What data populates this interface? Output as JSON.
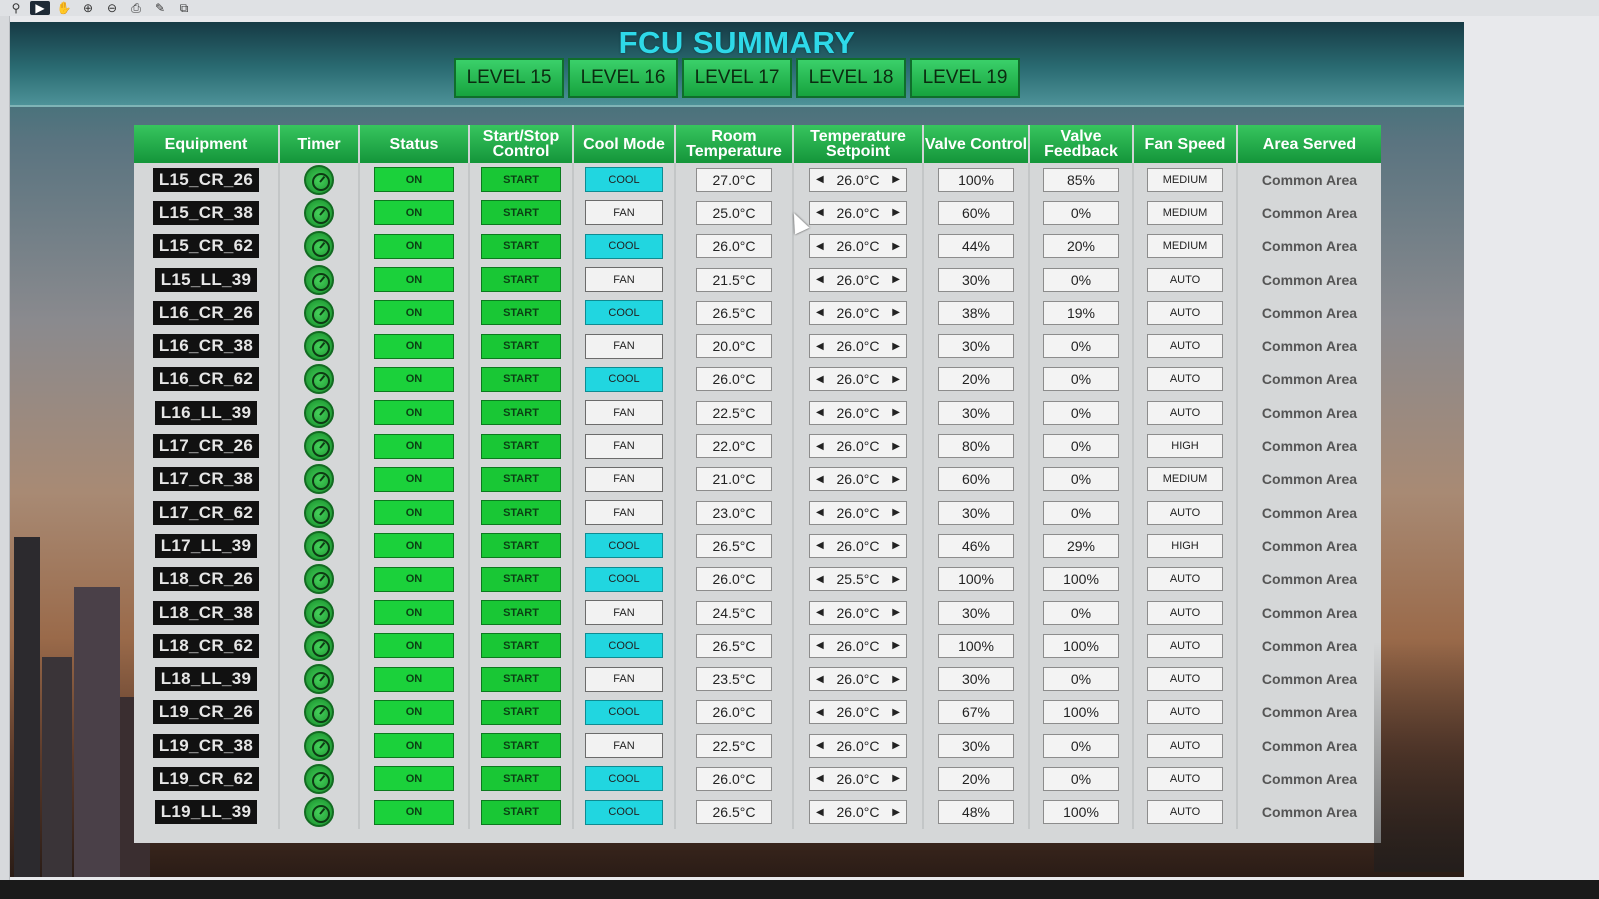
{
  "toolbar": {
    "tools": [
      "cursor-tool-icon",
      "select-icon",
      "hand-icon",
      "zoom-in-icon",
      "zoom-out-icon",
      "print-icon",
      "wrench-icon",
      "fit-page-icon"
    ]
  },
  "title": "FCU SUMMARY",
  "level_tabs": [
    "LEVEL 15",
    "LEVEL 16",
    "LEVEL 17",
    "LEVEL 18",
    "LEVEL 19"
  ],
  "colors": {
    "title": "#2ed9e8",
    "header_green": "#14953a",
    "on_green": "#1bd13b",
    "cool_cyan": "#21d6e0"
  },
  "columns": {
    "equipment": "Equipment",
    "timer": "Timer",
    "status": "Status",
    "start_stop": "Start/Stop Control",
    "cool_mode": "Cool Mode",
    "room_temp": "Room Temperature",
    "setpoint": "Temperature Setpoint",
    "valve_control": "Valve Control",
    "valve_feedback": "Valve Feedback",
    "fan_speed": "Fan Speed",
    "area_served": "Area Served"
  },
  "rows": [
    {
      "equipment": "L15_CR_26",
      "status": "ON",
      "control": "START",
      "mode": "COOL",
      "room_temp": "27.0°C",
      "setpoint": "26.0°C",
      "valve_control": "100%",
      "valve_feedback": "85%",
      "fan_speed": "MEDIUM",
      "area": "Common Area"
    },
    {
      "equipment": "L15_CR_38",
      "status": "ON",
      "control": "START",
      "mode": "FAN",
      "room_temp": "25.0°C",
      "setpoint": "26.0°C",
      "valve_control": "60%",
      "valve_feedback": "0%",
      "fan_speed": "MEDIUM",
      "area": "Common Area"
    },
    {
      "equipment": "L15_CR_62",
      "status": "ON",
      "control": "START",
      "mode": "COOL",
      "room_temp": "26.0°C",
      "setpoint": "26.0°C",
      "valve_control": "44%",
      "valve_feedback": "20%",
      "fan_speed": "MEDIUM",
      "area": "Common Area"
    },
    {
      "equipment": "L15_LL_39",
      "status": "ON",
      "control": "START",
      "mode": "FAN",
      "room_temp": "21.5°C",
      "setpoint": "26.0°C",
      "valve_control": "30%",
      "valve_feedback": "0%",
      "fan_speed": "AUTO",
      "area": "Common Area"
    },
    {
      "equipment": "L16_CR_26",
      "status": "ON",
      "control": "START",
      "mode": "COOL",
      "room_temp": "26.5°C",
      "setpoint": "26.0°C",
      "valve_control": "38%",
      "valve_feedback": "19%",
      "fan_speed": "AUTO",
      "area": "Common Area"
    },
    {
      "equipment": "L16_CR_38",
      "status": "ON",
      "control": "START",
      "mode": "FAN",
      "room_temp": "20.0°C",
      "setpoint": "26.0°C",
      "valve_control": "30%",
      "valve_feedback": "0%",
      "fan_speed": "AUTO",
      "area": "Common Area"
    },
    {
      "equipment": "L16_CR_62",
      "status": "ON",
      "control": "START",
      "mode": "COOL",
      "room_temp": "26.0°C",
      "setpoint": "26.0°C",
      "valve_control": "20%",
      "valve_feedback": "0%",
      "fan_speed": "AUTO",
      "area": "Common Area"
    },
    {
      "equipment": "L16_LL_39",
      "status": "ON",
      "control": "START",
      "mode": "FAN",
      "room_temp": "22.5°C",
      "setpoint": "26.0°C",
      "valve_control": "30%",
      "valve_feedback": "0%",
      "fan_speed": "AUTO",
      "area": "Common Area"
    },
    {
      "equipment": "L17_CR_26",
      "status": "ON",
      "control": "START",
      "mode": "FAN",
      "room_temp": "22.0°C",
      "setpoint": "26.0°C",
      "valve_control": "80%",
      "valve_feedback": "0%",
      "fan_speed": "HIGH",
      "area": "Common Area"
    },
    {
      "equipment": "L17_CR_38",
      "status": "ON",
      "control": "START",
      "mode": "FAN",
      "room_temp": "21.0°C",
      "setpoint": "26.0°C",
      "valve_control": "60%",
      "valve_feedback": "0%",
      "fan_speed": "MEDIUM",
      "area": "Common Area"
    },
    {
      "equipment": "L17_CR_62",
      "status": "ON",
      "control": "START",
      "mode": "FAN",
      "room_temp": "23.0°C",
      "setpoint": "26.0°C",
      "valve_control": "30%",
      "valve_feedback": "0%",
      "fan_speed": "AUTO",
      "area": "Common Area"
    },
    {
      "equipment": "L17_LL_39",
      "status": "ON",
      "control": "START",
      "mode": "COOL",
      "room_temp": "26.5°C",
      "setpoint": "26.0°C",
      "valve_control": "46%",
      "valve_feedback": "29%",
      "fan_speed": "HIGH",
      "area": "Common Area"
    },
    {
      "equipment": "L18_CR_26",
      "status": "ON",
      "control": "START",
      "mode": "COOL",
      "room_temp": "26.0°C",
      "setpoint": "25.5°C",
      "valve_control": "100%",
      "valve_feedback": "100%",
      "fan_speed": "AUTO",
      "area": "Common Area"
    },
    {
      "equipment": "L18_CR_38",
      "status": "ON",
      "control": "START",
      "mode": "FAN",
      "room_temp": "24.5°C",
      "setpoint": "26.0°C",
      "valve_control": "30%",
      "valve_feedback": "0%",
      "fan_speed": "AUTO",
      "area": "Common Area"
    },
    {
      "equipment": "L18_CR_62",
      "status": "ON",
      "control": "START",
      "mode": "COOL",
      "room_temp": "26.5°C",
      "setpoint": "26.0°C",
      "valve_control": "100%",
      "valve_feedback": "100%",
      "fan_speed": "AUTO",
      "area": "Common Area"
    },
    {
      "equipment": "L18_LL_39",
      "status": "ON",
      "control": "START",
      "mode": "FAN",
      "room_temp": "23.5°C",
      "setpoint": "26.0°C",
      "valve_control": "30%",
      "valve_feedback": "0%",
      "fan_speed": "AUTO",
      "area": "Common Area"
    },
    {
      "equipment": "L19_CR_26",
      "status": "ON",
      "control": "START",
      "mode": "COOL",
      "room_temp": "26.0°C",
      "setpoint": "26.0°C",
      "valve_control": "67%",
      "valve_feedback": "100%",
      "fan_speed": "AUTO",
      "area": "Common Area"
    },
    {
      "equipment": "L19_CR_38",
      "status": "ON",
      "control": "START",
      "mode": "FAN",
      "room_temp": "22.5°C",
      "setpoint": "26.0°C",
      "valve_control": "30%",
      "valve_feedback": "0%",
      "fan_speed": "AUTO",
      "area": "Common Area"
    },
    {
      "equipment": "L19_CR_62",
      "status": "ON",
      "control": "START",
      "mode": "COOL",
      "room_temp": "26.0°C",
      "setpoint": "26.0°C",
      "valve_control": "20%",
      "valve_feedback": "0%",
      "fan_speed": "AUTO",
      "area": "Common Area"
    },
    {
      "equipment": "L19_LL_39",
      "status": "ON",
      "control": "START",
      "mode": "COOL",
      "room_temp": "26.5°C",
      "setpoint": "26.0°C",
      "valve_control": "48%",
      "valve_feedback": "100%",
      "fan_speed": "AUTO",
      "area": "Common Area"
    }
  ]
}
